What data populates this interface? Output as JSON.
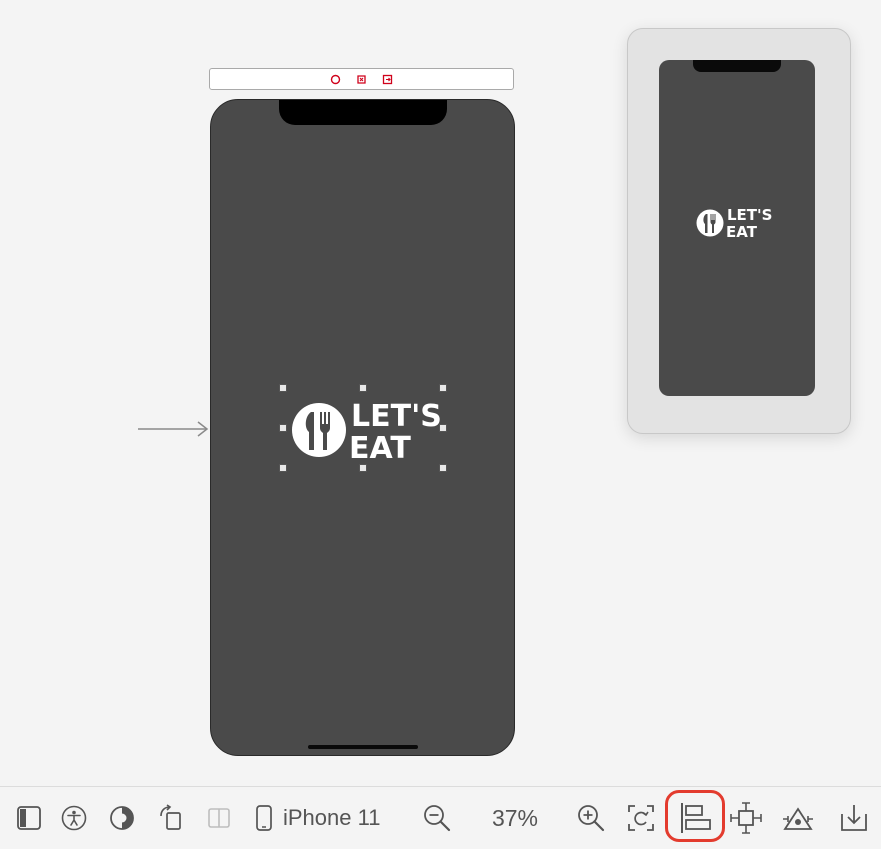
{
  "canvas": {
    "logo": {
      "line1": "LET'S",
      "line2": "EAT"
    },
    "preview_logo": {
      "line1": "LET'S",
      "line2": "EAT"
    }
  },
  "toolbar": {
    "device_label": "iPhone 11",
    "zoom_label": "37%",
    "icons": [
      "document-outline-icon",
      "accessibility-icon",
      "appearance-icon",
      "rotate-icon",
      "split-view-icon",
      "device-icon",
      "zoom-out-icon",
      "zoom-in-icon",
      "update-frames-icon",
      "align-icon",
      "add-constraints-icon",
      "resolve-autolayout-icon",
      "embed-in-icon"
    ],
    "highlight_color": "#e33b2e"
  },
  "colors": {
    "canvas_bg": "#f4f4f4",
    "screen_bg": "#4a4a4a",
    "icon_color": "#555555",
    "dock_icon_red": "#d0021b"
  }
}
